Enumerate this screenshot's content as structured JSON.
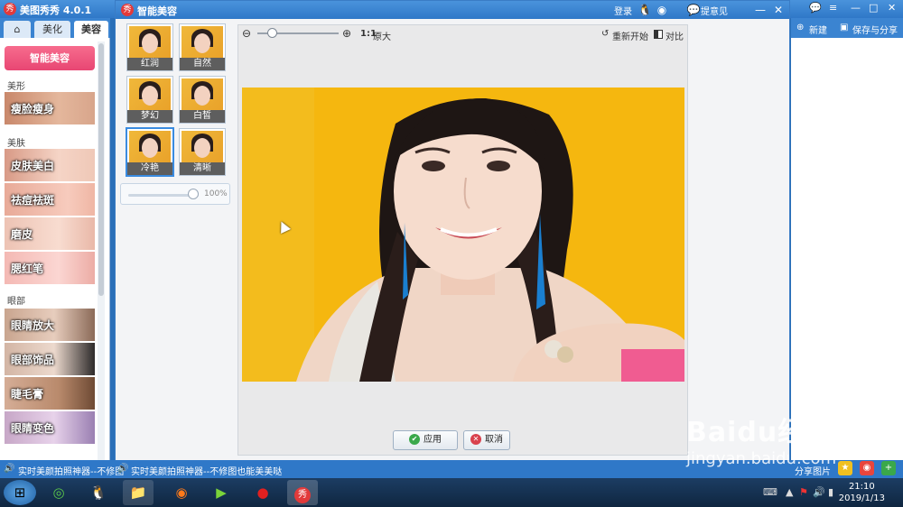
{
  "app": {
    "title": "美图秀秀 4.0.1",
    "logo_text": "秀",
    "login": "登录",
    "feedback": "提意见"
  },
  "tabs": [
    {
      "label": "⌂"
    },
    {
      "label": "美化"
    },
    {
      "label": "美容"
    }
  ],
  "left": {
    "smart_button": "智能美容",
    "sections": {
      "shape": "美形",
      "skin": "美肤",
      "eyes": "眼部"
    },
    "features": [
      {
        "label": "瘦脸瘦身"
      },
      {
        "label": "皮肤美白"
      },
      {
        "label": "祛痘祛斑"
      },
      {
        "label": "磨皮"
      },
      {
        "label": "腮红笔"
      },
      {
        "label": "眼睛放大"
      },
      {
        "label": "眼部饰品"
      },
      {
        "label": "睫毛膏"
      },
      {
        "label": "眼睛变色"
      }
    ]
  },
  "dialog": {
    "title": "智能美容",
    "presets": [
      {
        "label": "红润"
      },
      {
        "label": "自然"
      },
      {
        "label": "梦幻"
      },
      {
        "label": "白皙"
      },
      {
        "label": "冷艳"
      },
      {
        "label": "清晰"
      }
    ],
    "strength": {
      "value_text": "100%",
      "fraction": 1.0
    },
    "zoom": {
      "ratio_label": "1:1",
      "original_label": "原大",
      "fraction": 0.18
    },
    "restart": "重新开始",
    "compare": "对比",
    "apply": "应用",
    "cancel": "取消"
  },
  "right": {
    "new": "新建",
    "save_share": "保存与分享",
    "share_image": "分享图片"
  },
  "status": {
    "left_text": "实时美颜拍照神器--不修图",
    "main_text": "实时美颜拍照神器--不修图也能美美哒"
  },
  "clock": {
    "time": "21:10",
    "date": "2019/1/13"
  },
  "watermark": {
    "brand": "Baidu经验",
    "url": "jingyan.baidu.com"
  },
  "colors": {
    "accent": "#2f78c8",
    "smart_button": "#e84673",
    "photo_bg": "#f5b70f"
  }
}
